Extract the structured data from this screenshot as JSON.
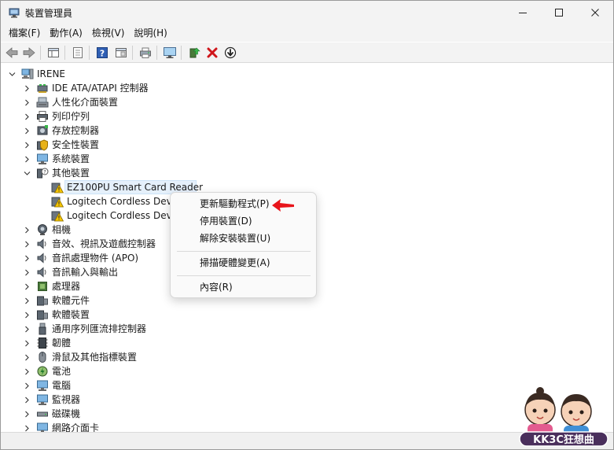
{
  "window": {
    "title": "裝置管理員"
  },
  "menubar": {
    "items": [
      {
        "label": "檔案(F)"
      },
      {
        "label": "動作(A)"
      },
      {
        "label": "檢視(V)"
      },
      {
        "label": "說明(H)"
      }
    ]
  },
  "tree": {
    "root": {
      "label": "IRENE"
    },
    "items": [
      {
        "label": "IDE ATA/ATAPI 控制器",
        "icon": "ide-icon"
      },
      {
        "label": "人性化介面裝置",
        "icon": "hid-icon"
      },
      {
        "label": "列印佇列",
        "icon": "printer-icon"
      },
      {
        "label": "存放控制器",
        "icon": "storage-icon"
      },
      {
        "label": "安全性裝置",
        "icon": "security-icon"
      },
      {
        "label": "系統裝置",
        "icon": "system-icon"
      },
      {
        "label": "其他裝置",
        "icon": "other-devices-icon",
        "expanded": true
      },
      {
        "label": "EZ100PU Smart Card Reader",
        "icon": "warning-device-icon",
        "child": true,
        "selected": true
      },
      {
        "label": "Logitech Cordless Device",
        "icon": "warning-device-icon",
        "child": true
      },
      {
        "label": "Logitech Cordless Device",
        "icon": "warning-device-icon",
        "child": true
      },
      {
        "label": "相機",
        "icon": "camera-icon"
      },
      {
        "label": "音效、視訊及遊戲控制器",
        "icon": "speaker-icon"
      },
      {
        "label": "音訊處理物件 (APO)",
        "icon": "speaker-icon"
      },
      {
        "label": "音訊輸入與輸出",
        "icon": "speaker-icon"
      },
      {
        "label": "處理器",
        "icon": "processor-icon"
      },
      {
        "label": "軟體元件",
        "icon": "software-component-icon"
      },
      {
        "label": "軟體裝置",
        "icon": "software-device-icon"
      },
      {
        "label": "通用序列匯流排控制器",
        "icon": "usb-icon"
      },
      {
        "label": "韌體",
        "icon": "firmware-icon"
      },
      {
        "label": "滑鼠及其他指標裝置",
        "icon": "mouse-icon"
      },
      {
        "label": "電池",
        "icon": "battery-icon"
      },
      {
        "label": "電腦",
        "icon": "computer-icon"
      },
      {
        "label": "監視器",
        "icon": "monitor-icon"
      },
      {
        "label": "磁碟機",
        "icon": "disk-icon"
      },
      {
        "label": "網路介面卡",
        "icon": "network-icon"
      }
    ]
  },
  "context_menu": {
    "items": [
      {
        "label": "更新驅動程式(P)"
      },
      {
        "label": "停用裝置(D)"
      },
      {
        "label": "解除安裝裝置(U)"
      },
      {
        "label": "掃描硬體變更(A)"
      },
      {
        "label": "內容(R)"
      }
    ]
  },
  "watermark": {
    "text": "KK3C狂想曲"
  },
  "colors": {
    "accent_selection": "#e5f0fb",
    "warning": "#f5c400",
    "annotation_arrow": "#e8151b",
    "close_x": "#d0161b"
  }
}
